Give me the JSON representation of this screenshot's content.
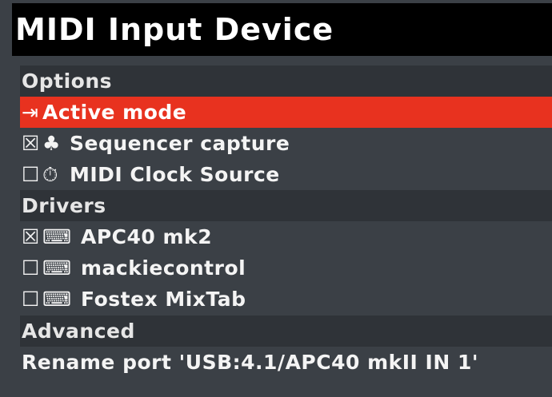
{
  "window": {
    "title": "MIDI Input Device"
  },
  "options": {
    "header": "Options",
    "active_mode": {
      "icon": "⇥",
      "label": "Active mode"
    },
    "sequencer_capture": {
      "check": "☒",
      "icon": "♣",
      "label": "Sequencer capture"
    },
    "midi_clock_source": {
      "check": "☐",
      "icon": "⏱",
      "label": "MIDI Clock Source"
    }
  },
  "drivers": {
    "header": "Drivers",
    "items": [
      {
        "check": "☒",
        "icon": "⌨",
        "label": "APC40 mk2"
      },
      {
        "check": "☐",
        "icon": "⌨",
        "label": "mackiecontrol"
      },
      {
        "check": "☐",
        "icon": "⌨",
        "label": "Fostex MixTab"
      }
    ]
  },
  "advanced": {
    "header": "Advanced",
    "rename_label": "Rename port 'USB:4.1/APC40 mkII IN 1'"
  },
  "colors": {
    "active_highlight": "#e8321f",
    "background": "#3b4046",
    "section_background": "#2f3338",
    "title_background": "#000000"
  }
}
